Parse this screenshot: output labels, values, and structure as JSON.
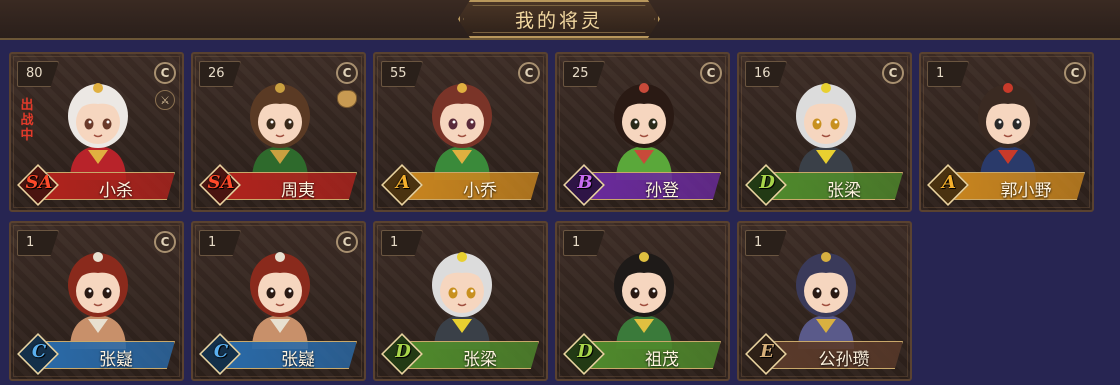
{
  "header": {
    "title": "我的将灵"
  },
  "grade_colors": {
    "SA": {
      "plate": "#b0231d",
      "text": "#ff4a2a",
      "fill": "#4a1410"
    },
    "A": {
      "plate": "#c8851f",
      "text": "#f5b02c",
      "fill": "#4a3210"
    },
    "B": {
      "plate": "#6a2a9c",
      "text": "#c86cf0",
      "fill": "#2e1446"
    },
    "D": {
      "plate": "#4f8a2c",
      "text": "#a8d64a",
      "fill": "#223a14"
    },
    "C": {
      "plate": "#2a6aa8",
      "text": "#5ab0f0",
      "fill": "#14304a"
    },
    "E": {
      "plate": "#5a3a2a",
      "text": "#d8b07a",
      "fill": "#2e2016"
    }
  },
  "cards": [
    {
      "name": "小杀",
      "level": "80",
      "grade": "SA",
      "badge": "C",
      "deployed": "出战中",
      "extra_icon": "sword-icon",
      "portrait": "white-hair-girl"
    },
    {
      "name": "周夷",
      "level": "26",
      "grade": "SA",
      "badge": "C",
      "deployed": "",
      "extra_icon": "pot-icon",
      "portrait": "green-archer-girl"
    },
    {
      "name": "小乔",
      "level": "55",
      "grade": "A",
      "badge": "C",
      "deployed": "",
      "extra_icon": "",
      "portrait": "pink-hair-girl"
    },
    {
      "name": "孙登",
      "level": "25",
      "grade": "B",
      "badge": "C",
      "deployed": "",
      "extra_icon": "",
      "portrait": "green-robe-boy"
    },
    {
      "name": "张梁",
      "level": "16",
      "grade": "D",
      "badge": "C",
      "deployed": "",
      "extra_icon": "",
      "portrait": "white-hair-elder"
    },
    {
      "name": "郭小野",
      "level": "1",
      "grade": "A",
      "badge": "C",
      "deployed": "",
      "extra_icon": "",
      "portrait": "modern-boy"
    },
    {
      "name": "张嶷",
      "level": "1",
      "grade": "C",
      "badge": "C",
      "deployed": "",
      "extra_icon": "",
      "portrait": "red-hair-warrior"
    },
    {
      "name": "张嶷",
      "level": "1",
      "grade": "C",
      "badge": "C",
      "deployed": "",
      "extra_icon": "",
      "portrait": "red-hair-warrior"
    },
    {
      "name": "张梁",
      "level": "1",
      "grade": "D",
      "badge": "",
      "deployed": "",
      "extra_icon": "",
      "portrait": "white-hair-elder"
    },
    {
      "name": "祖茂",
      "level": "1",
      "grade": "D",
      "badge": "",
      "deployed": "",
      "extra_icon": "",
      "portrait": "headband-warrior"
    },
    {
      "name": "公孙瓒",
      "level": "1",
      "grade": "E",
      "badge": "",
      "deployed": "",
      "extra_icon": "",
      "portrait": "horned-general"
    }
  ]
}
